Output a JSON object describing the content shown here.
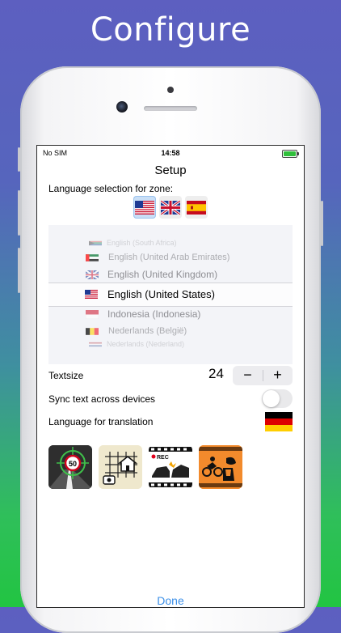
{
  "marketing": {
    "headline": "Configure"
  },
  "status_bar": {
    "carrier": "No SIM",
    "time": "14:58"
  },
  "screen": {
    "title": "Setup",
    "zone_label": "Language selection for zone:",
    "zone_flags": [
      {
        "name": "us-flag-icon",
        "selected": true
      },
      {
        "name": "uk-flag-icon",
        "selected": false
      },
      {
        "name": "spain-flag-icon",
        "selected": false
      }
    ],
    "picker": {
      "items": [
        {
          "label": "English (South Africa)",
          "flag": "south-africa-flag-icon"
        },
        {
          "label": "English (United Arab Emirates)",
          "flag": "uae-flag-icon"
        },
        {
          "label": "English (United Kingdom)",
          "flag": "uk-flag-icon"
        },
        {
          "label": "English (United States)",
          "flag": "us-flag-icon"
        },
        {
          "label": "Indonesia (Indonesia)",
          "flag": "indonesia-flag-icon"
        },
        {
          "label": "Nederlands (België)",
          "flag": "belgium-flag-icon"
        },
        {
          "label": "Nederlands (Nederland)",
          "flag": "netherlands-flag-icon"
        }
      ],
      "selected_index": 3
    },
    "textsize": {
      "label": "Textsize",
      "value": "24",
      "minus": "−",
      "plus": "+"
    },
    "sync": {
      "label": "Sync text across devices",
      "on": false
    },
    "translation": {
      "label": "Language for translation",
      "flag": "germany-flag-icon"
    },
    "related_apps": [
      {
        "name": "speed-camera-app-icon",
        "sign_value": "50"
      },
      {
        "name": "home-grid-app-icon"
      },
      {
        "name": "dashcam-rec-app-icon",
        "badge": "REC"
      },
      {
        "name": "sports-app-icon"
      }
    ],
    "done_label": "Done"
  },
  "colors": {
    "accent": "#3b8fe8",
    "selected_flag_bg": "#c9dff7"
  }
}
